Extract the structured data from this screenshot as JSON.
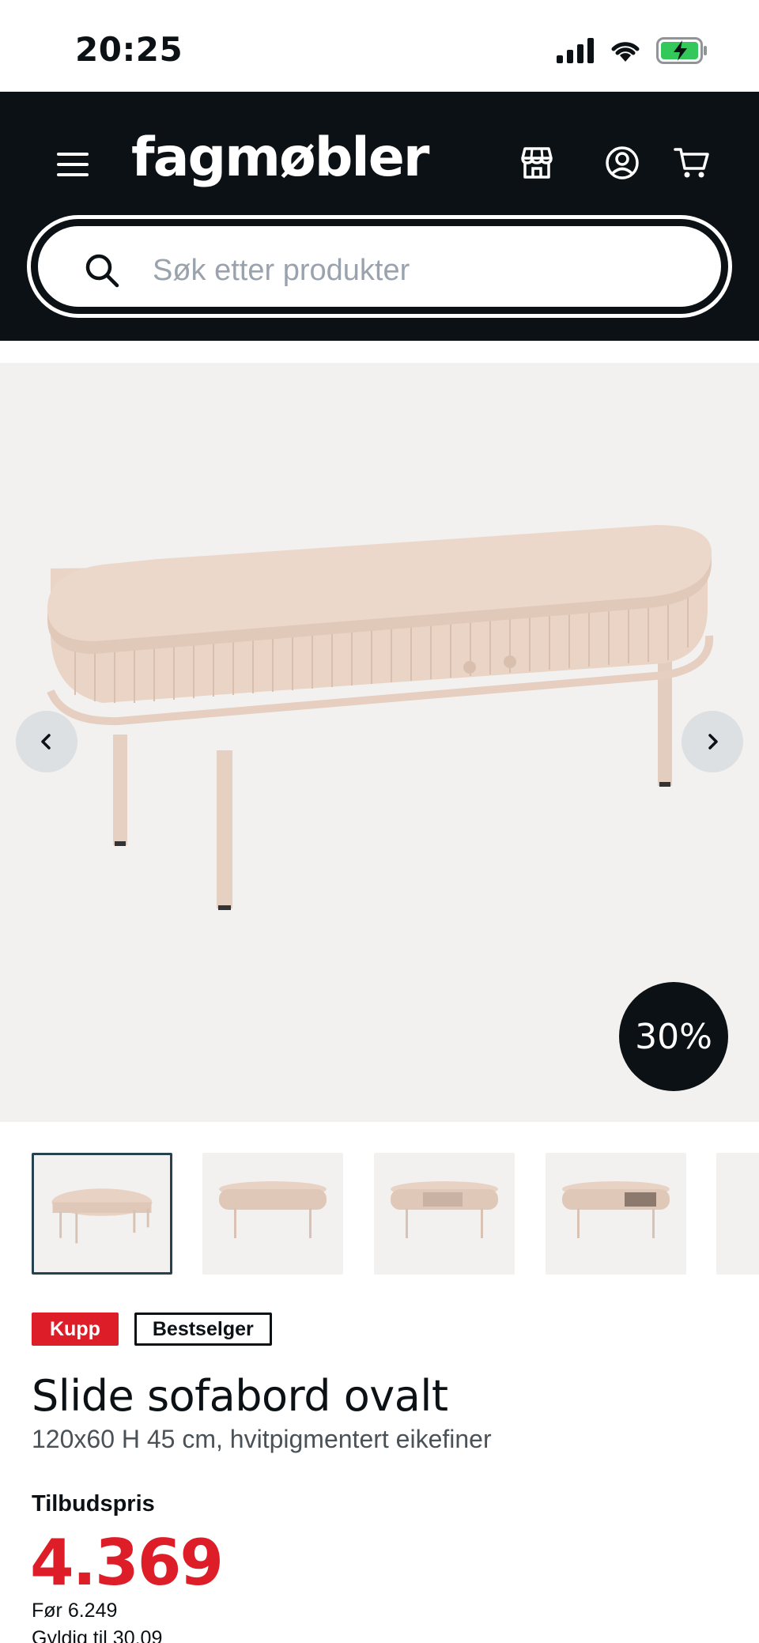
{
  "status_bar": {
    "time": "20:25"
  },
  "header": {
    "logo_text": "fagmøbler",
    "background_color": "#0b1114"
  },
  "search": {
    "placeholder": "Søk etter produkter",
    "value": ""
  },
  "gallery": {
    "discount_label": "30%",
    "thumbnail_count": 5,
    "active_thumbnail_index": 0
  },
  "product": {
    "badges": {
      "kupp": "Kupp",
      "bestseller": "Bestselger"
    },
    "title": "Slide sofabord ovalt",
    "subtitle": "120x60 H 45 cm, hvitpigmentert eikefiner",
    "price_label": "Tilbudspris",
    "price": "4.369",
    "before_price": "Før 6.249",
    "valid_until": "Gyldig til 30.09"
  },
  "colors": {
    "accent_red": "#dd1d28",
    "dark": "#0b1114",
    "gallery_bg": "#f2f1ef"
  }
}
